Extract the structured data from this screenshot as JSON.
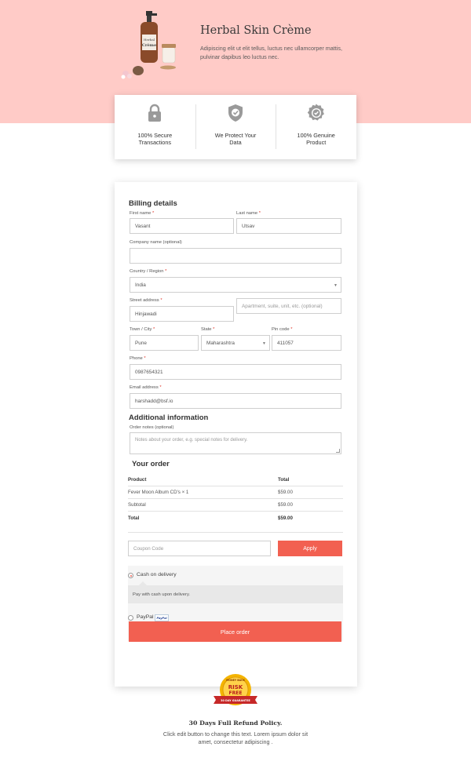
{
  "hero": {
    "title": "Herbal Skin Crème",
    "description": "Adipiscing elit ut elit tellus, luctus nec ullamcorper mattis, pulvinar dapibus leo luctus nec.",
    "product_label_line1": "Herbal",
    "product_label_line2": "Crème",
    "background": "#ffcbc7"
  },
  "features": [
    {
      "icon": "lock-icon",
      "label": "100% Secure Transactions"
    },
    {
      "icon": "shield-check-icon",
      "label": "We Protect Your Data"
    },
    {
      "icon": "badge-check-icon",
      "label": "100% Genuine Product"
    }
  ],
  "billing": {
    "heading": "Billing details",
    "first_name_label": "First name",
    "first_name_value": "Vasant",
    "last_name_label": "Last name",
    "last_name_value": "Utsav",
    "company_label": "Company name (optional)",
    "company_value": "",
    "country_label": "Country / Region",
    "country_value": "India",
    "street_label": "Street address",
    "street_value": "Hinjawadi",
    "street2_placeholder": "Apartment, suite, unit, etc. (optional)",
    "town_label": "Town / City",
    "town_value": "Pune",
    "state_label": "State",
    "state_value": "Maharashtra",
    "pin_label": "Pin code",
    "pin_value": "411057",
    "phone_label": "Phone",
    "phone_value": "0987654321",
    "email_label": "Email address",
    "email_value": "harshadd@bsf.io",
    "required_mark": "*"
  },
  "additional": {
    "heading": "Additional information",
    "notes_label": "Order notes (optional)",
    "notes_placeholder": "Notes about your order, e.g. special notes for delivery."
  },
  "order": {
    "heading": "Your order",
    "columns": [
      "Product",
      "Total"
    ],
    "rows": [
      {
        "product": "Fever Moon Album CD's  × 1",
        "total": "$59.00"
      },
      {
        "product": "Subtotal",
        "total": "$59.00"
      },
      {
        "product": "Total",
        "total": "$59.00"
      }
    ]
  },
  "coupon": {
    "placeholder": "Coupon Code",
    "apply_label": "Apply"
  },
  "payment": {
    "cod_label": "Cash on delivery",
    "cod_description": "Pay with cash upon delivery.",
    "paypal_label": "PayPal",
    "paypal_badge": "PayPal",
    "selected": "cod"
  },
  "place_order_label": "Place order",
  "guarantee_badge": {
    "top_text": "MONEY BACK",
    "line1": "RISK",
    "line2": "FREE",
    "ribbon": "30 DAY GUARANTEE"
  },
  "refund": {
    "title": "30 Days Full Refund Policy.",
    "text": "Click edit button to change this text. Lorem ipsum dolor sit amet, consectetur adipiscing ."
  },
  "colors": {
    "accent": "#f26051",
    "required": "#e0372b",
    "icon_gray": "#9a9a9a"
  }
}
